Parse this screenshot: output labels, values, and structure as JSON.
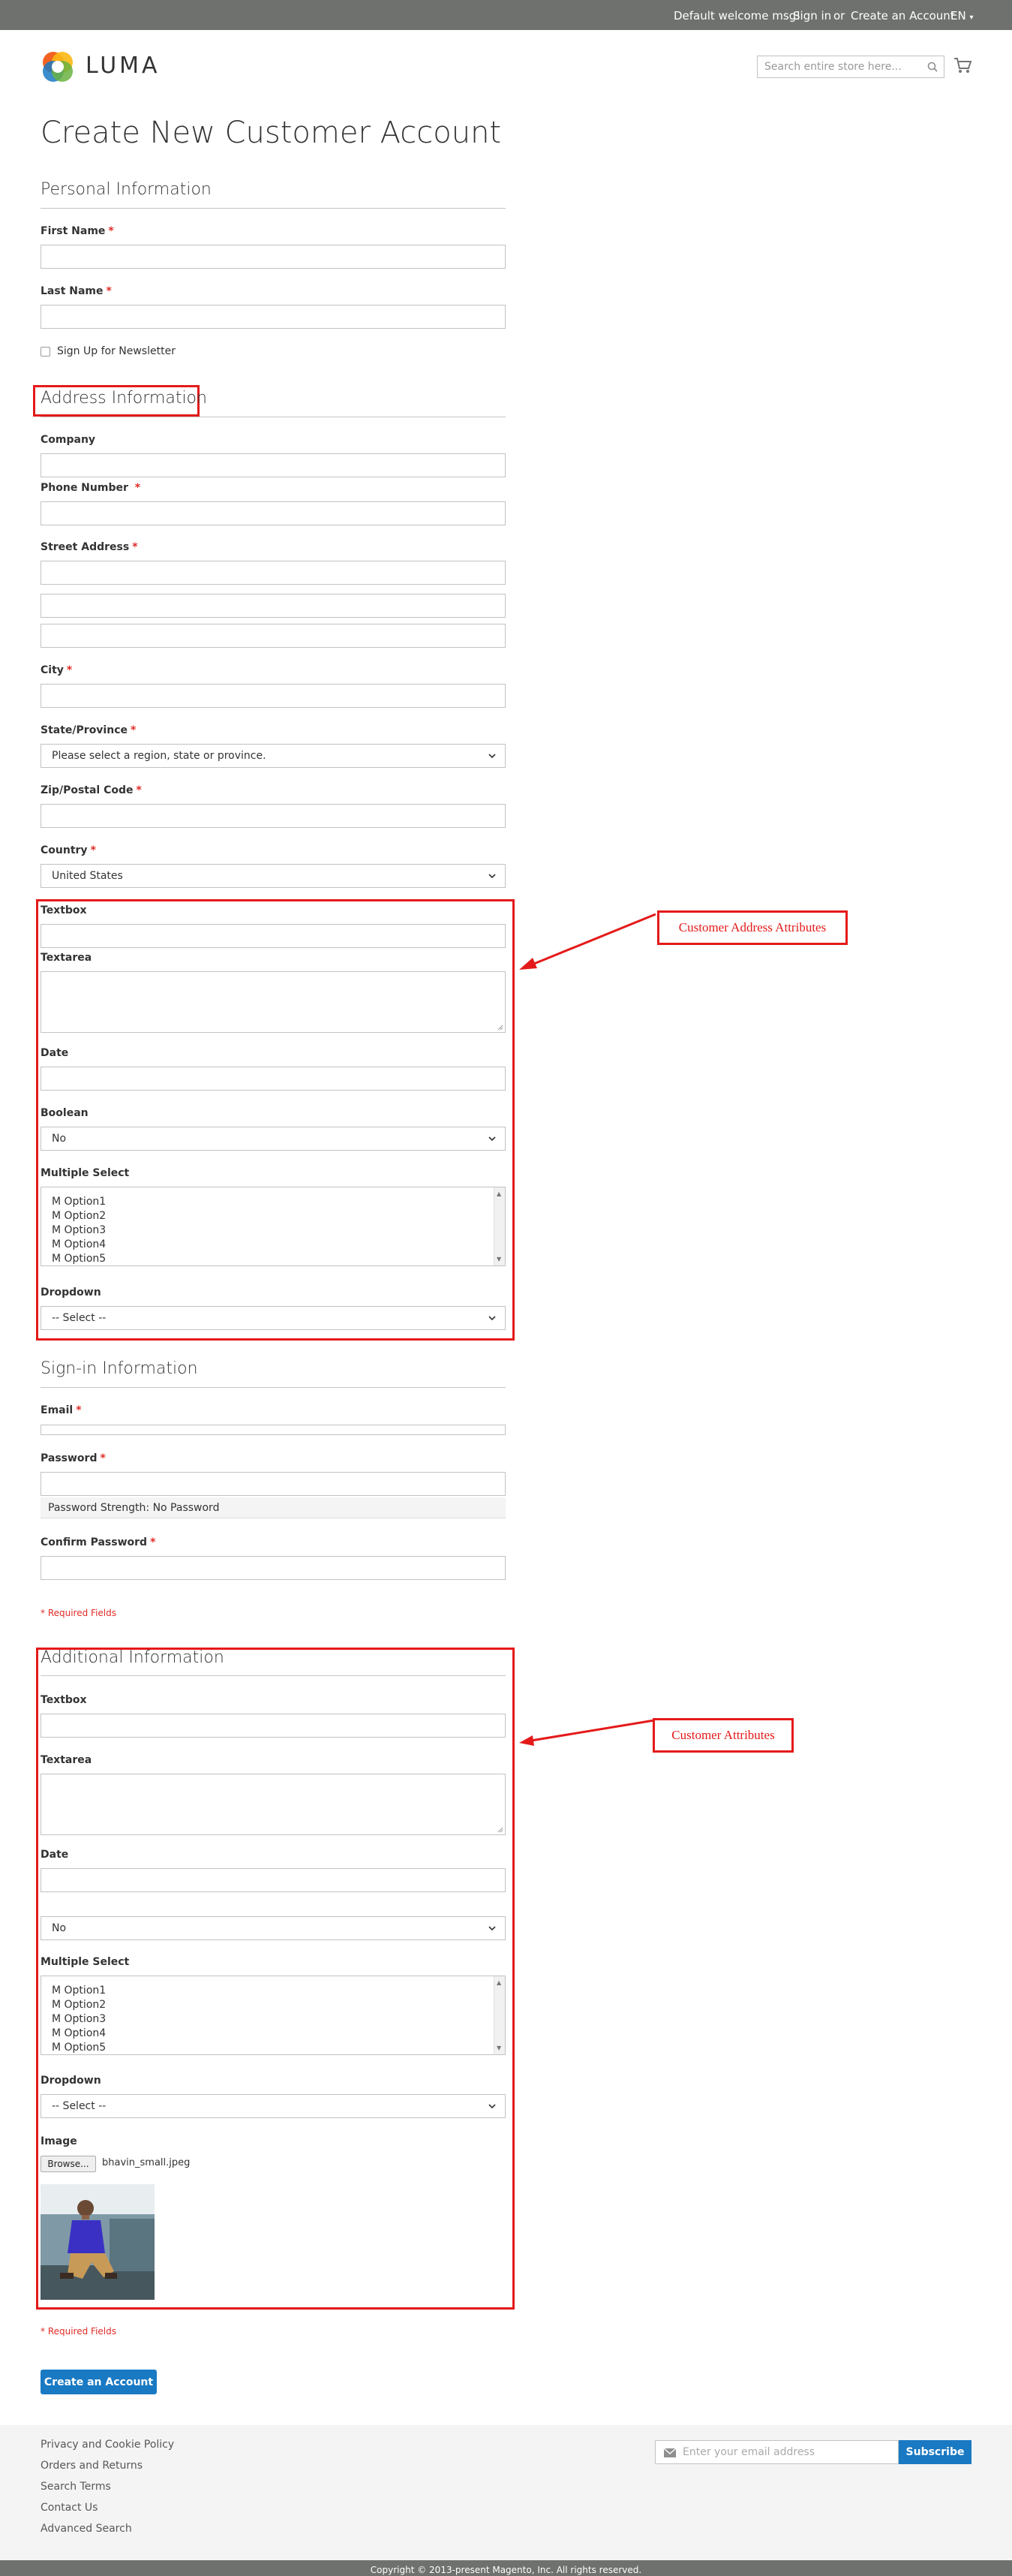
{
  "topbar": {
    "welcome": "Default welcome msg!",
    "sign_in": "Sign in",
    "or": "or",
    "create_account": "Create an Account",
    "language": "EN"
  },
  "header": {
    "logo_text": "LUMA",
    "search_placeholder": "Search entire store here..."
  },
  "page_title": "Create New Customer Account",
  "personal": {
    "legend": "Personal Information",
    "first_name": "First Name",
    "last_name": "Last Name",
    "newsletter": "Sign Up for Newsletter"
  },
  "address": {
    "legend": "Address Information",
    "company": "Company",
    "phone": "Phone Number",
    "street": "Street Address",
    "city": "City",
    "state": "State/Province",
    "state_value": "Please select a region, state or province.",
    "zip": "Zip/Postal Code",
    "country": "Country",
    "country_value": "United States"
  },
  "address_attrs": {
    "textbox": "Textbox",
    "textarea": "Textarea",
    "date": "Date",
    "boolean": "Boolean",
    "boolean_value": "No",
    "multiselect": "Multiple Select",
    "options": [
      "M Option1",
      "M Option2",
      "M Option3",
      "M Option4",
      "M Option5"
    ],
    "dropdown": "Dropdown",
    "dropdown_value": "-- Select --"
  },
  "callouts": {
    "address_attrs": "Customer Address Attributes",
    "customer_attrs": "Customer Attributes"
  },
  "signin": {
    "legend": "Sign-in Information",
    "email": "Email",
    "password": "Password",
    "strength": "Password Strength: No Password",
    "confirm": "Confirm Password",
    "required_note": "* Required Fields"
  },
  "additional": {
    "legend": "Additional Information",
    "textbox": "Textbox",
    "textarea": "Textarea",
    "date": "Date",
    "boolean_value": "No",
    "multiselect": "Multiple Select",
    "options": [
      "M Option1",
      "M Option2",
      "M Option3",
      "M Option4",
      "M Option5"
    ],
    "dropdown": "Dropdown",
    "dropdown_value": "-- Select --",
    "image": "Image",
    "browse": "Browse...",
    "file_name": "bhavin_small.jpeg",
    "required_note": "* Required Fields"
  },
  "submit_label": "Create an Account",
  "footer": {
    "links": [
      "Privacy and Cookie Policy",
      "Orders and Returns",
      "Search Terms",
      "Contact Us",
      "Advanced Search"
    ],
    "newsletter_placeholder": "Enter your email address",
    "subscribe": "Subscribe",
    "copyright": "Copyright © 2013-present Magento, Inc. All rights reserved."
  },
  "colors": {
    "accent": "#1979c3",
    "required": "#e02b27",
    "annotation": "#e41a1a",
    "topbar": "#6e716e"
  }
}
